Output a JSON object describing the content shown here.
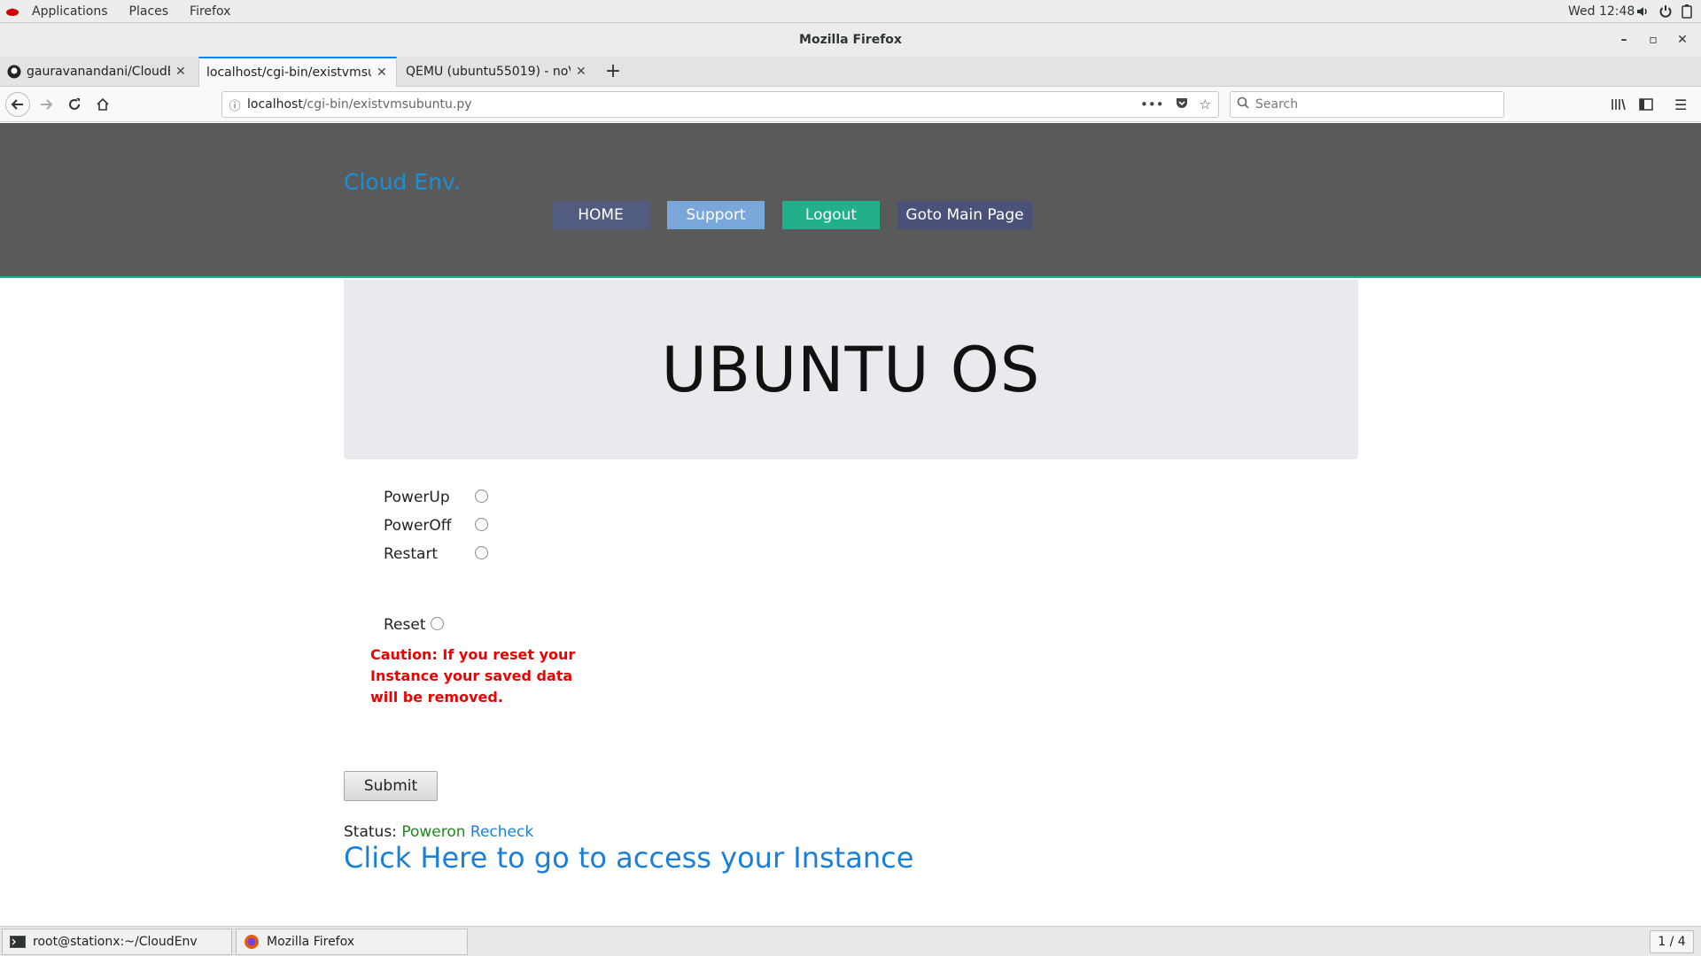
{
  "topbar": {
    "menus": [
      "Applications",
      "Places",
      "Firefox"
    ],
    "clock": "Wed 12:48"
  },
  "window": {
    "title": "Mozilla Firefox"
  },
  "tabs": [
    {
      "label": "gauravanandani/CloudEnv"
    },
    {
      "label": "localhost/cgi-bin/existvmsubuntu.py"
    },
    {
      "label": "QEMU (ubuntu55019) - noVNC"
    }
  ],
  "urlbar": {
    "host": "localhost",
    "path": "/cgi-bin/existvmsubuntu.py"
  },
  "search": {
    "placeholder": "Search"
  },
  "page": {
    "brand": "Cloud Env.",
    "nav": {
      "home": "HOME",
      "support": "Support",
      "logout": "Logout",
      "main": "Goto Main Page"
    },
    "heading": "UBUNTU OS",
    "options": {
      "powerup": "PowerUp",
      "poweroff": "PowerOff",
      "restart": "Restart",
      "reset": "Reset"
    },
    "caution": "Caution: If you reset your Instance your saved data will be removed.",
    "submit": "Submit",
    "status_label": "Status:",
    "status_value": "Poweron",
    "recheck": "Recheck",
    "access_link": "Click Here to go to access your Instance"
  },
  "taskbar": {
    "terminal": "root@stationx:~/CloudEnv",
    "firefox": "Mozilla Firefox",
    "pager": "1 / 4"
  },
  "colors": {
    "header_bg": "#5a5a5a",
    "brand": "#1a8fd6",
    "home_btn": "#525b80",
    "support_btn": "#7aa7d9",
    "logout_btn": "#22b08a",
    "main_btn": "#4b5279",
    "caution": "#ee0000",
    "status_ok": "#1a8a1a",
    "link": "#1a7fd9"
  }
}
